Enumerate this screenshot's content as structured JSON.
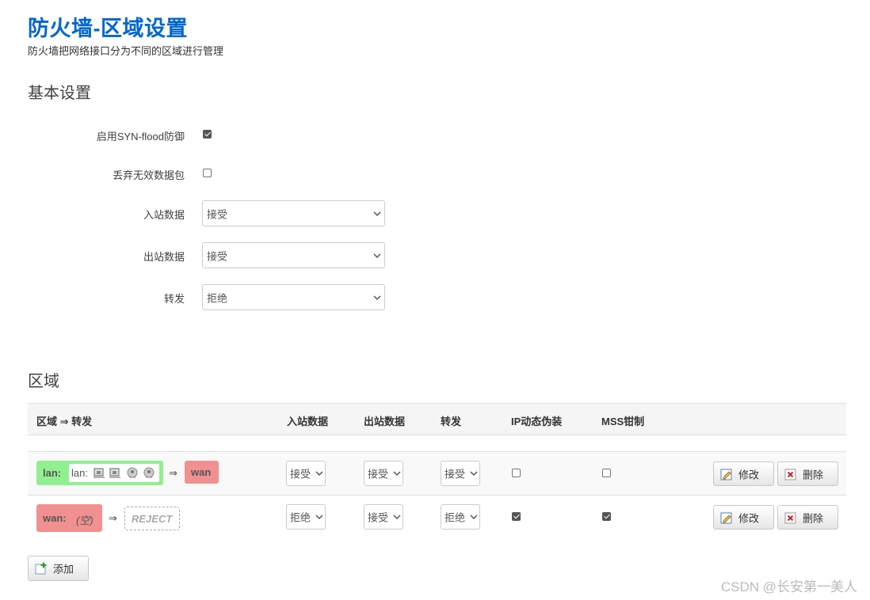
{
  "header": {
    "title": "防火墙-区域设置",
    "description": "防火墙把网络接口分为不同的区域进行管理"
  },
  "basic": {
    "section_title": "基本设置",
    "syn_flood_label": "启用SYN-flood防御",
    "syn_flood_checked": true,
    "drop_invalid_label": "丢弃无效数据包",
    "drop_invalid_checked": false,
    "input_label": "入站数据",
    "input_value": "接受",
    "output_label": "出站数据",
    "output_value": "接受",
    "forward_label": "转发",
    "forward_value": "拒绝"
  },
  "zones": {
    "section_title": "区域",
    "columns": {
      "zone_forward": "区域 ⇒ 转发",
      "input": "入站数据",
      "output": "出站数据",
      "forward": "转发",
      "masq": "IP动态伪装",
      "mss": "MSS钳制"
    },
    "arrow": "⇒",
    "rows": [
      {
        "zone": "lan:",
        "iface_label": "lan:",
        "zone_color": "#90f090",
        "forward_target": "wan",
        "forward_target_color": "#f09090",
        "input": "接受",
        "output": "接受",
        "forward": "接受",
        "masq": false,
        "mss": false,
        "edit": "修改",
        "delete": "删除"
      },
      {
        "zone": "wan:",
        "empty_label": "(空)",
        "zone_color": "#f09090",
        "forward_target": "REJECT",
        "input": "拒绝",
        "output": "接受",
        "forward": "拒绝",
        "masq": true,
        "mss": true,
        "edit": "修改",
        "delete": "删除"
      }
    ],
    "add_label": "添加"
  },
  "watermark": "CSDN @长安第一美人",
  "colors": {
    "title": "#0066cc",
    "lan": "#90f090",
    "wan": "#f09090"
  }
}
